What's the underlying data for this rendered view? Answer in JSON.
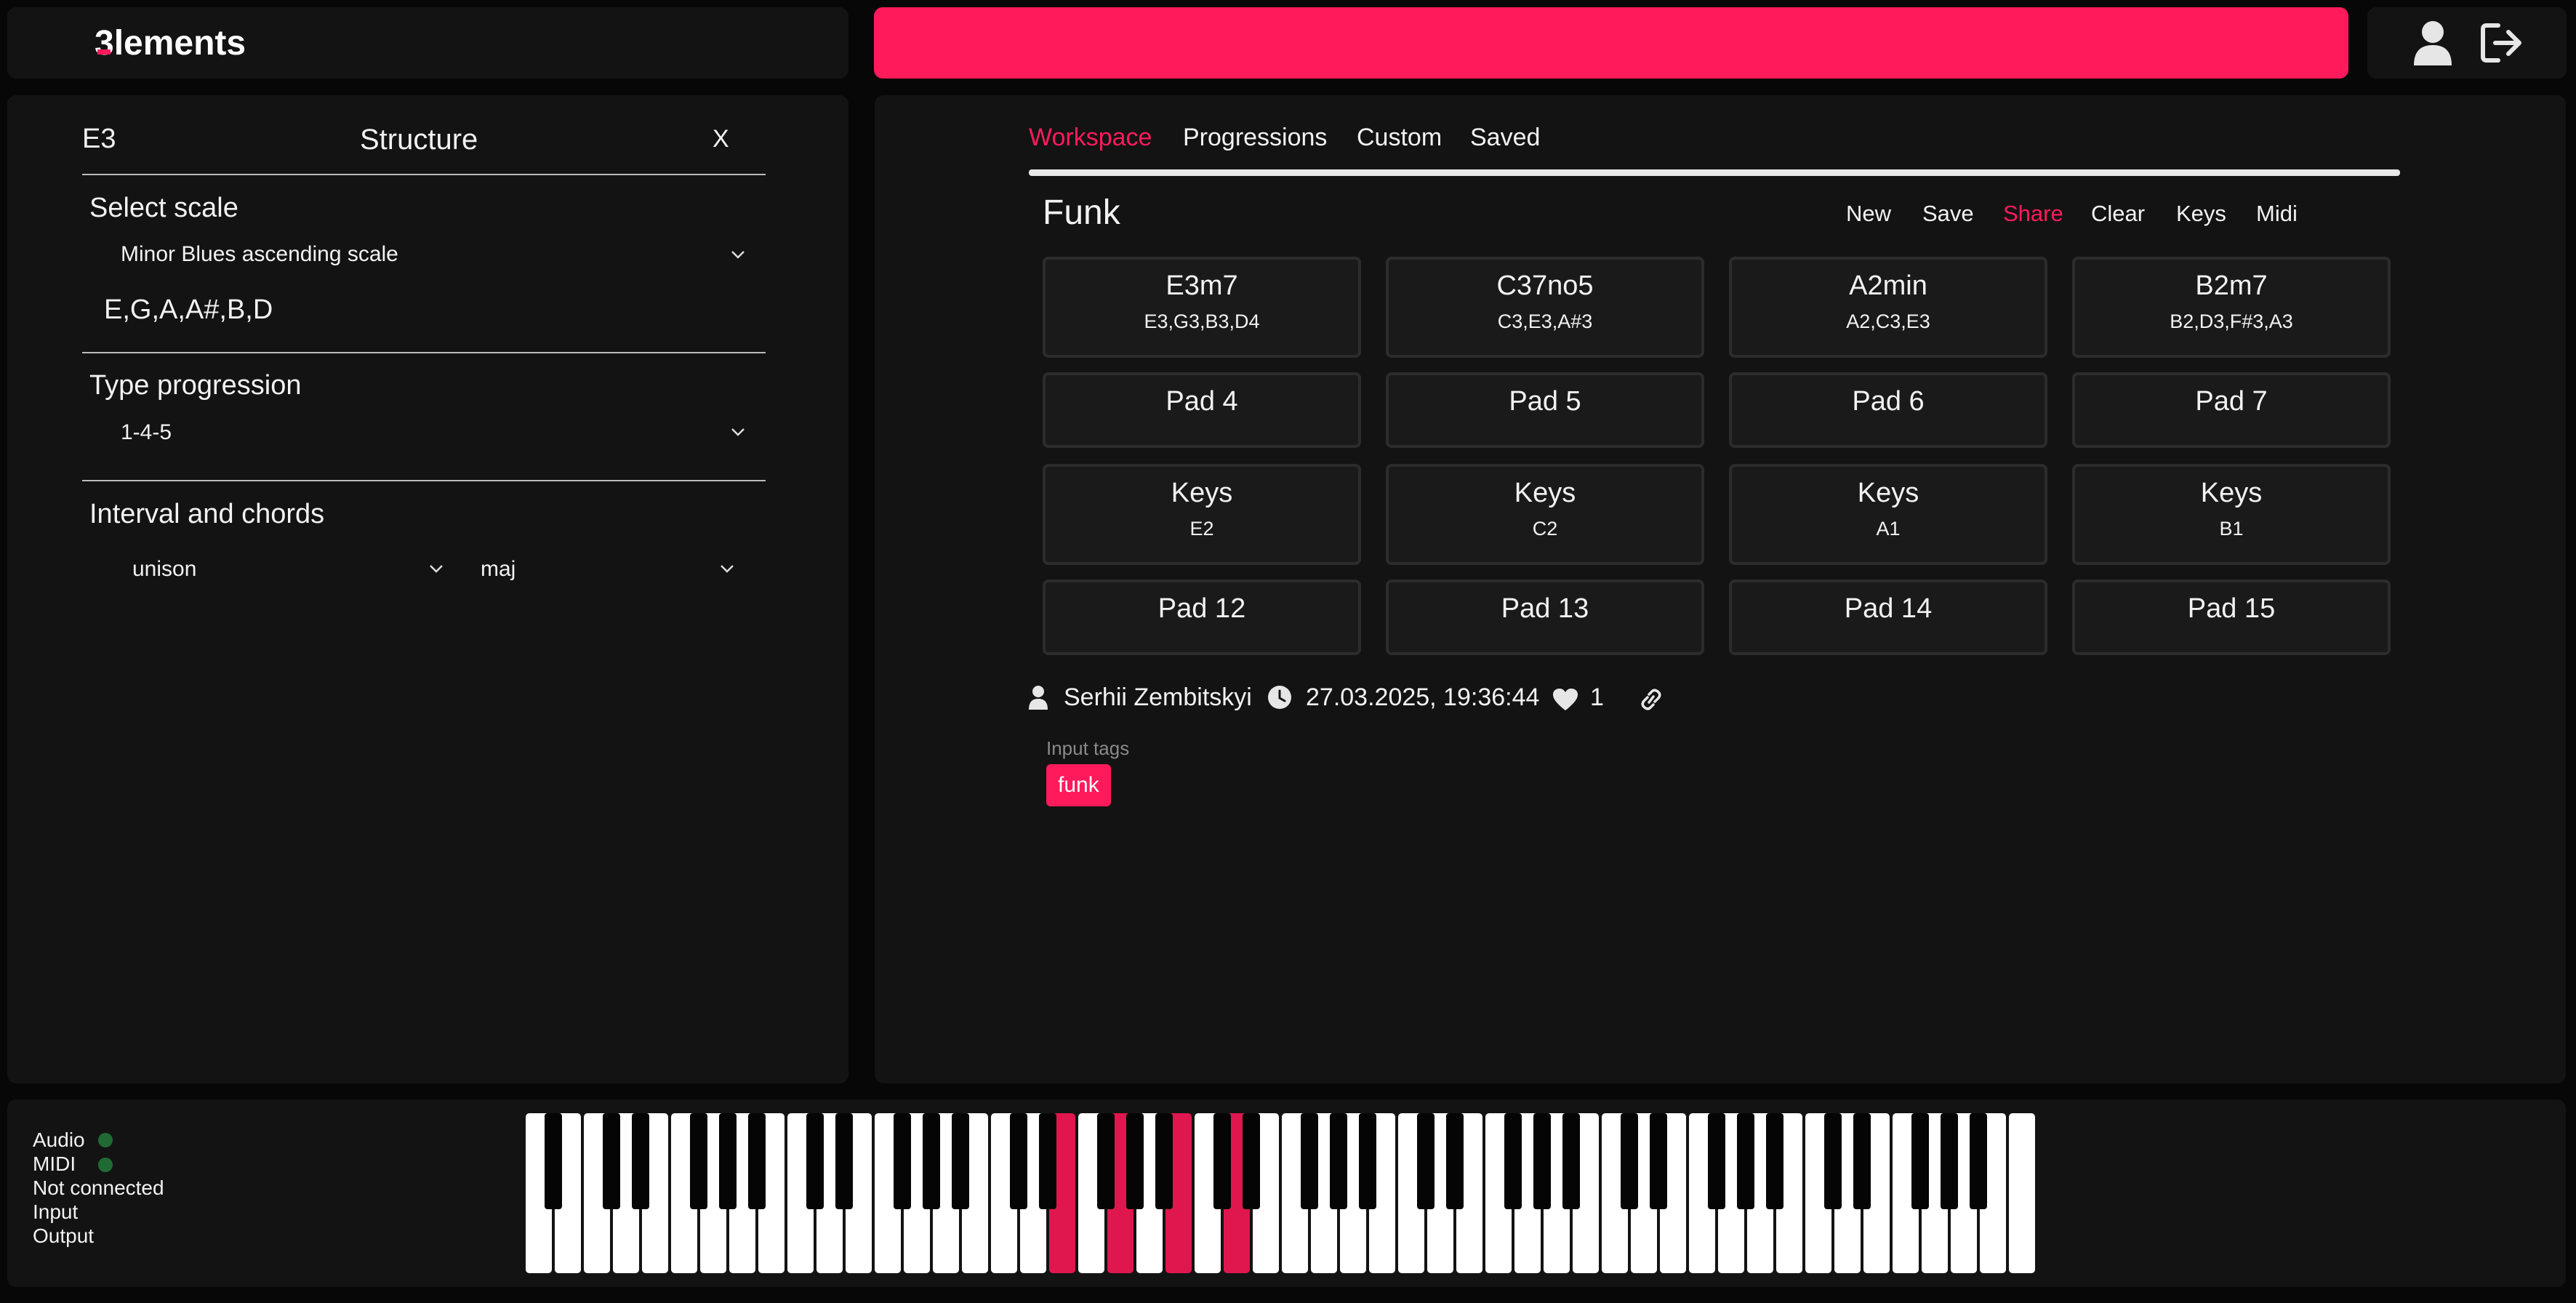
{
  "app": {
    "logo_text": "lements",
    "logo_mark": "3"
  },
  "header": {
    "icons": [
      "user-icon",
      "logout-icon"
    ],
    "banner_color": "#ff1a5c"
  },
  "left_panel": {
    "root_note": "E3",
    "title": "Structure",
    "close_label": "X",
    "scale": {
      "label": "Select scale",
      "selected": "Minor Blues ascending scale",
      "notes": "E,G,A,A#,B,D"
    },
    "progression": {
      "label": "Type progression",
      "selected": "1-4-5"
    },
    "interval": {
      "label": "Interval and chords",
      "interval_selected": "unison",
      "chord_selected": "maj"
    }
  },
  "tabs": [
    {
      "label": "Workspace",
      "active": true
    },
    {
      "label": "Progressions",
      "active": false
    },
    {
      "label": "Custom",
      "active": false
    },
    {
      "label": "Saved",
      "active": false
    }
  ],
  "progression_name": "Funk",
  "toolbar": {
    "new": "New",
    "save": "Save",
    "share": "Share",
    "clear": "Clear",
    "keys": "Keys",
    "midi": "Midi"
  },
  "pads": [
    {
      "name": "E3m7",
      "notes": "E3,G3,B3,D4"
    },
    {
      "name": "C37no5",
      "notes": "C3,E3,A#3"
    },
    {
      "name": "A2min",
      "notes": "A2,C3,E3"
    },
    {
      "name": "B2m7",
      "notes": "B2,D3,F#3,A3"
    },
    {
      "name": "Pad 4",
      "notes": ""
    },
    {
      "name": "Pad 5",
      "notes": ""
    },
    {
      "name": "Pad 6",
      "notes": ""
    },
    {
      "name": "Pad 7",
      "notes": ""
    },
    {
      "name": "Keys",
      "notes": "E2"
    },
    {
      "name": "Keys",
      "notes": "C2"
    },
    {
      "name": "Keys",
      "notes": "A1"
    },
    {
      "name": "Keys",
      "notes": "B1"
    },
    {
      "name": "Pad 12",
      "notes": ""
    },
    {
      "name": "Pad 13",
      "notes": ""
    },
    {
      "name": "Pad 14",
      "notes": ""
    },
    {
      "name": "Pad 15",
      "notes": ""
    }
  ],
  "meta": {
    "author": "Serhii Zembitskyi",
    "timestamp": "27.03.2025, 19:36:44",
    "likes": "1"
  },
  "tags": {
    "label": "Input tags",
    "items": [
      "funk"
    ]
  },
  "status": {
    "audio": "Audio",
    "midi": "MIDI",
    "connection": "Not connected",
    "input": "Input",
    "output": "Output",
    "dot_color": "#1f6b33"
  },
  "keyboard": {
    "white_key_count": 52,
    "highlight_color": "#e0174f",
    "highlighted_white_indices": [
      18,
      20,
      22,
      24
    ]
  }
}
